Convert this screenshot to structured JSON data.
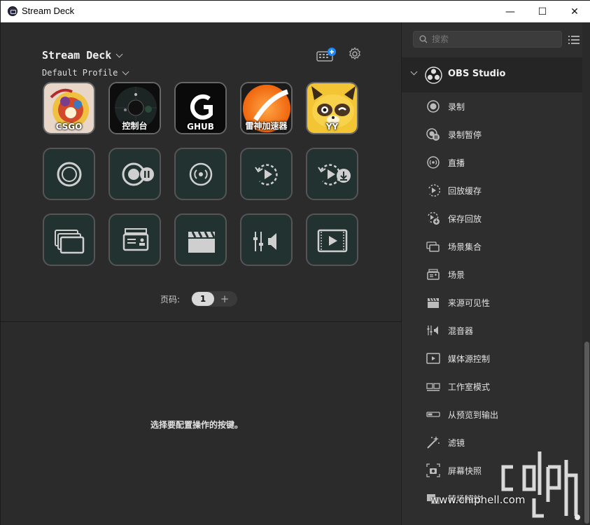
{
  "window": {
    "title": "Stream Deck",
    "controls": {
      "minimize": "—",
      "maximize": "☐",
      "close": "✕"
    }
  },
  "device": {
    "name": "Stream Deck",
    "profile": "Default Profile"
  },
  "keys": {
    "row1": [
      {
        "label": "CSGO",
        "icon": "csgo-app-icon"
      },
      {
        "label": "控制台",
        "icon": "console-app-icon"
      },
      {
        "label": "GHUB",
        "icon": "logitech-ghub-icon"
      },
      {
        "label": "雷神加速器",
        "icon": "accelerator-app-icon"
      },
      {
        "label": "YY",
        "icon": "yy-raccoon-icon"
      }
    ],
    "row2": [
      {
        "icon": "record-icon"
      },
      {
        "icon": "record-pause-icon"
      },
      {
        "icon": "stream-icon"
      },
      {
        "icon": "replay-buffer-icon"
      },
      {
        "icon": "save-replay-icon"
      }
    ],
    "row3": [
      {
        "icon": "scene-collection-icon"
      },
      {
        "icon": "scene-icon"
      },
      {
        "icon": "clapper-icon"
      },
      {
        "icon": "mixer-icon"
      },
      {
        "icon": "media-source-icon"
      }
    ]
  },
  "pager": {
    "label": "页码:",
    "current": "1",
    "add": "+"
  },
  "hint": "选择要配置操作的按键。",
  "search": {
    "placeholder": "搜索"
  },
  "category": {
    "name": "OBS Studio"
  },
  "actions": [
    {
      "label": "录制",
      "icon": "record-icon"
    },
    {
      "label": "录制暂停",
      "icon": "record-pause-icon"
    },
    {
      "label": "直播",
      "icon": "stream-icon"
    },
    {
      "label": "回放缓存",
      "icon": "replay-buffer-icon"
    },
    {
      "label": "保存回放",
      "icon": "save-replay-icon"
    },
    {
      "label": "场景集合",
      "icon": "scene-collection-icon"
    },
    {
      "label": "场景",
      "icon": "scene-icon"
    },
    {
      "label": "来源可见性",
      "icon": "clapper-icon"
    },
    {
      "label": "混音器",
      "icon": "mixer-icon"
    },
    {
      "label": "媒体源控制",
      "icon": "media-source-icon"
    },
    {
      "label": "工作室模式",
      "icon": "studio-mode-icon"
    },
    {
      "label": "从预览到输出",
      "icon": "preview-to-output-icon"
    },
    {
      "label": "滤镜",
      "icon": "filter-wand-icon"
    },
    {
      "label": "屏幕快照",
      "icon": "screenshot-icon"
    },
    {
      "label": "转场特效",
      "icon": "transition-icon"
    }
  ],
  "watermark": {
    "logo": "chip hell",
    "url": "www.chiphell.com"
  },
  "colors": {
    "key_bg": "#223230",
    "panel_bg": "#2b2b2b",
    "accent": "#1e88ff"
  }
}
